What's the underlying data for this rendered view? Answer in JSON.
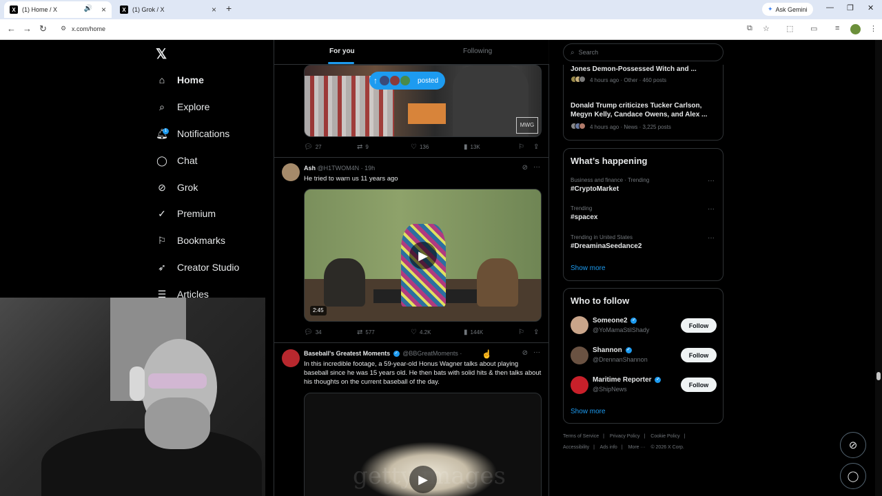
{
  "browser": {
    "tabs": [
      {
        "title": "(1) Home / X",
        "active": true
      },
      {
        "title": "(1) Grok / X",
        "active": false
      }
    ],
    "ask_gemini": "Ask Gemini",
    "url": "x.com/home"
  },
  "nav": {
    "items": [
      {
        "label": "Home",
        "icon": "home-icon"
      },
      {
        "label": "Explore",
        "icon": "search-icon"
      },
      {
        "label": "Notifications",
        "icon": "bell-icon",
        "badge": "1"
      },
      {
        "label": "Chat",
        "icon": "chat-icon"
      },
      {
        "label": "Grok",
        "icon": "grok-icon"
      },
      {
        "label": "Premium",
        "icon": "premium-icon"
      },
      {
        "label": "Bookmarks",
        "icon": "bookmark-icon"
      },
      {
        "label": "Creator Studio",
        "icon": "rocket-icon"
      },
      {
        "label": "Articles",
        "icon": "articles-icon"
      }
    ]
  },
  "feed": {
    "tab_for_you": "For you",
    "tab_following": "Following",
    "posted_pill": "posted",
    "post1": {
      "replies": "27",
      "reposts": "9",
      "likes": "136",
      "views": "13K"
    },
    "post2": {
      "name": "Ash",
      "handle": "@H1TWOM4N · 19h",
      "text": "He tried to warn us 11 years ago",
      "duration": "2:45",
      "replies": "34",
      "reposts": "577",
      "likes": "4.2K",
      "views": "144K"
    },
    "post3": {
      "name": "Baseball's Greatest Moments",
      "handle": "@BBGreatMoments ·",
      "text": "In this incredible footage, a 59-year-old Honus Wagner talks about playing baseball since he was 15 years old. He then bats with solid hits & then talks about his thoughts on the current baseball of the day."
    }
  },
  "sidebar": {
    "search_placeholder": "Search",
    "top_trends": [
      {
        "title": "Jones Demon-Possessed Witch and ...",
        "meta": "4 hours ago · Other · 460 posts"
      },
      {
        "title": "Donald Trump criticizes Tucker Carlson, Megyn Kelly, Candace Owens, and Alex ...",
        "meta": "4 hours ago · News · 3,225 posts"
      }
    ],
    "whats_happening": {
      "title": "What’s happening",
      "trends": [
        {
          "category": "Business and finance · Trending",
          "tag": "#CryptoMarket"
        },
        {
          "category": "Trending",
          "tag": "#spacex"
        },
        {
          "category": "Trending in United States",
          "tag": "#DreaminaSeedance2"
        }
      ],
      "show_more": "Show more"
    },
    "who_to_follow": {
      "title": "Who to follow",
      "accounts": [
        {
          "name": "Someone2",
          "handle": "@YoMamaStilShady",
          "button": "Follow"
        },
        {
          "name": "Shannon",
          "handle": "@DrennanShannon",
          "button": "Follow"
        },
        {
          "name": "Maritime Reporter",
          "handle": "@ShipNews",
          "button": "Follow"
        }
      ],
      "show_more": "Show more"
    },
    "footer": {
      "line1": [
        "Terms of Service",
        "|",
        "Privacy Policy",
        "|",
        "Cookie Policy",
        "|"
      ],
      "line2": [
        "Accessibility",
        "|",
        "Ads info",
        "|",
        "More ···",
        "© 2026 X Corp."
      ]
    }
  },
  "colors": {
    "accent": "#1d9bf0",
    "bg": "#000000",
    "border": "#2f3336",
    "muted": "#71767b"
  }
}
